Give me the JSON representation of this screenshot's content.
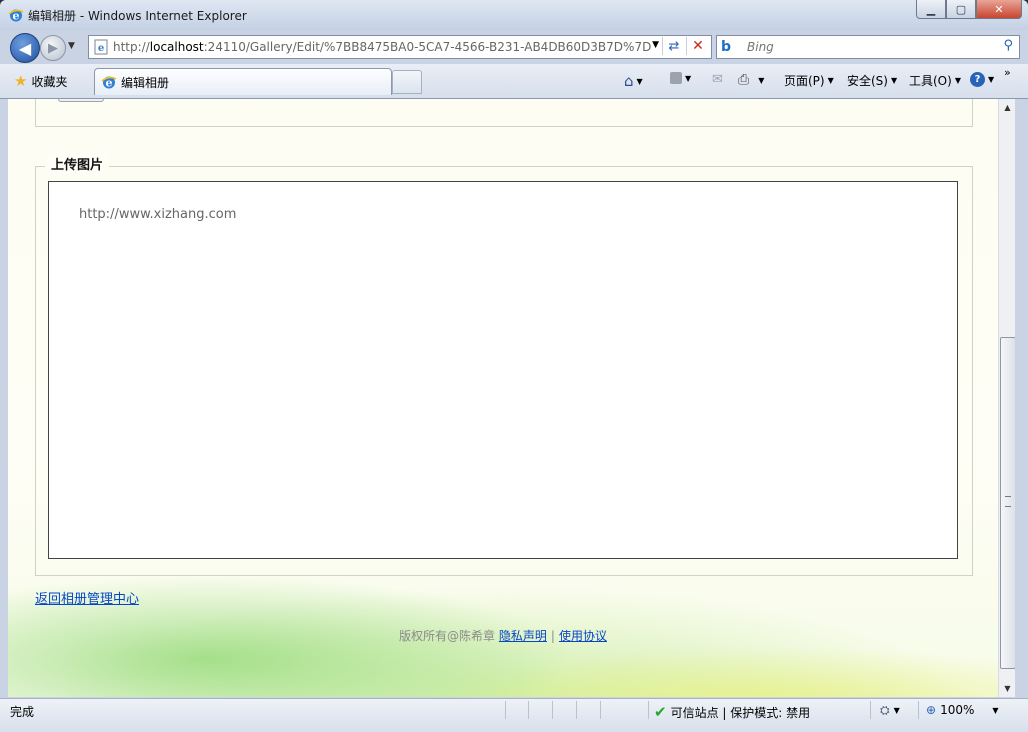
{
  "window": {
    "title": "编辑相册 - Windows Internet Explorer",
    "buttons": {
      "minimize": "▁",
      "maximize": "▢",
      "close": "✕"
    }
  },
  "navigation": {
    "back_glyph": "◀",
    "forward_glyph": "▶",
    "address": {
      "prefix": "http://",
      "host": "localhost",
      "rest": ":24110/Gallery/Edit/%7BB8475BA0-5CA7-4566-B231-AB4DB60D3B7D%7D"
    },
    "search_placeholder": "Bing",
    "search_logo": "b"
  },
  "favorites_label": "收藏夹",
  "tab": {
    "title": "编辑相册"
  },
  "command_bar": {
    "page": "页面(P)",
    "safety": "安全(S)",
    "tools": "工具(O)",
    "help": "?",
    "more": "»"
  },
  "page": {
    "upload_legend": "上传图片",
    "upload_placeholder": "http://www.xizhang.com",
    "back_link": "返回相册管理中心",
    "footer": {
      "copyright": "版权所有@陈希章",
      "privacy": "隐私声明",
      "separator": "|",
      "terms": "使用协议"
    }
  },
  "status": {
    "text": "完成",
    "zone": "可信站点 | 保护模式: 禁用",
    "zoom": "100%"
  }
}
